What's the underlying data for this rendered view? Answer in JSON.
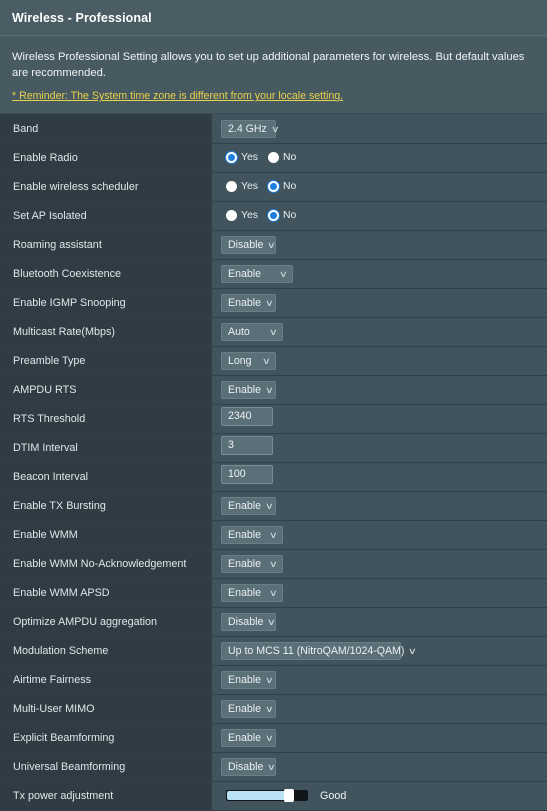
{
  "header": {
    "title": "Wireless - Professional"
  },
  "intro": {
    "description": "Wireless Professional Setting allows you to set up additional parameters for wireless. But default values are recommended.",
    "reminder": "* Reminder: The System time zone is different from your locale setting."
  },
  "icons": {
    "chevron_down": "∨"
  },
  "radio_labels": {
    "yes": "Yes",
    "no": "No"
  },
  "rows": [
    {
      "label": "Band",
      "type": "select",
      "value": "2.4 GHz",
      "width": "w-sm"
    },
    {
      "label": "Enable Radio",
      "type": "radio",
      "value": "yes"
    },
    {
      "label": "Enable wireless scheduler",
      "type": "radio",
      "value": "no"
    },
    {
      "label": "Set AP Isolated",
      "type": "radio",
      "value": "no"
    },
    {
      "label": "Roaming assistant",
      "type": "select",
      "value": "Disable",
      "width": "w-sm"
    },
    {
      "label": "Bluetooth Coexistence",
      "type": "select",
      "value": "Enable",
      "width": "w-lg"
    },
    {
      "label": "Enable IGMP Snooping",
      "type": "select",
      "value": "Enable",
      "width": "w-sm"
    },
    {
      "label": "Multicast Rate(Mbps)",
      "type": "select",
      "value": "Auto",
      "width": "w-md"
    },
    {
      "label": "Preamble Type",
      "type": "select",
      "value": "Long",
      "width": "w-sm"
    },
    {
      "label": "AMPDU RTS",
      "type": "select",
      "value": "Enable",
      "width": "w-sm"
    },
    {
      "label": "RTS Threshold",
      "type": "input",
      "value": "2340"
    },
    {
      "label": "DTIM Interval",
      "type": "input",
      "value": "3"
    },
    {
      "label": "Beacon Interval",
      "type": "input",
      "value": "100"
    },
    {
      "label": "Enable TX Bursting",
      "type": "select",
      "value": "Enable",
      "width": "w-sm"
    },
    {
      "label": "Enable WMM",
      "type": "select",
      "value": "Enable",
      "width": "w-md"
    },
    {
      "label": "Enable WMM No-Acknowledgement",
      "type": "select",
      "value": "Enable",
      "width": "w-md"
    },
    {
      "label": "Enable WMM APSD",
      "type": "select",
      "value": "Enable",
      "width": "w-md"
    },
    {
      "label": "Optimize AMPDU aggregation",
      "type": "select",
      "value": "Disable",
      "width": "w-sm"
    },
    {
      "label": "Modulation Scheme",
      "type": "select",
      "value": "Up to MCS 11 (NitroQAM/1024-QAM)",
      "width": "w-xl"
    },
    {
      "label": "Airtime Fairness",
      "type": "select",
      "value": "Enable",
      "width": "w-sm"
    },
    {
      "label": "Multi-User MIMO",
      "type": "select",
      "value": "Enable",
      "width": "w-sm"
    },
    {
      "label": "Explicit Beamforming",
      "type": "select",
      "value": "Enable",
      "width": "w-sm"
    },
    {
      "label": "Universal Beamforming",
      "type": "select",
      "value": "Disable",
      "width": "w-sm"
    },
    {
      "label": "Tx power adjustment",
      "type": "slider",
      "value": "Good",
      "percent": 72
    }
  ]
}
